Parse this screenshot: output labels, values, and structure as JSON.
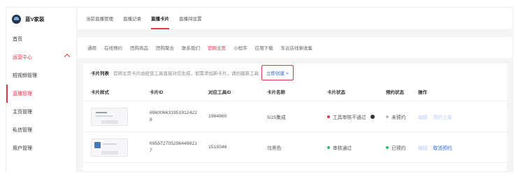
{
  "app": {
    "logo_text": "蓝V家装"
  },
  "sidebar": {
    "items": [
      {
        "label": "首页",
        "state": "normal"
      },
      {
        "label": "运营中心",
        "state": "group"
      },
      {
        "label": "短视频管理",
        "state": "normal"
      },
      {
        "label": "直播管理",
        "state": "active"
      },
      {
        "label": "主页管理",
        "state": "normal"
      },
      {
        "label": "私信管理",
        "state": "normal"
      },
      {
        "label": "用户管理",
        "state": "normal"
      }
    ]
  },
  "topbar": {
    "tabs": [
      {
        "label": "当前直播管理",
        "active": false
      },
      {
        "label": "直播记录",
        "active": false
      },
      {
        "label": "直播卡片",
        "active": true
      },
      {
        "label": "直播间设置",
        "active": false
      }
    ]
  },
  "subtabs": [
    {
      "label": "通用",
      "active": false
    },
    {
      "label": "在线预约",
      "active": false
    },
    {
      "label": "团购商品",
      "active": false
    },
    {
      "label": "团购聚合",
      "active": false
    },
    {
      "label": "联系我们",
      "active": false
    },
    {
      "label": "官网主页",
      "active": true
    },
    {
      "label": "小程序",
      "active": false
    },
    {
      "label": "应用下载",
      "active": false
    },
    {
      "label": "车云店线索收集",
      "active": false
    }
  ],
  "panel": {
    "title": "卡片列表",
    "description": "官网主页卡片由经营工具直接对应生成，如需添加新卡片，请创建新工具",
    "create_link": "立即创建 >"
  },
  "table": {
    "headers": [
      "卡片样式",
      "卡片ID",
      "对应工具ID",
      "卡片名称",
      "卡片状态",
      "预约状态",
      "操作"
    ],
    "rows": [
      {
        "card_id": "6960066319519124228",
        "tool_id": "1964860",
        "name": "5/25集成",
        "status": "工具审核不通过",
        "status_color": "#e8334a",
        "reserve": "未预约",
        "reserve_color": "#b7bcc4",
        "actions": [
          "编辑",
          "预约上架"
        ],
        "thumb": "text"
      },
      {
        "card_id": "6955727052964498217",
        "tool_id": "1518346",
        "name": "乌黑色",
        "status": "审核通过",
        "status_color": "#2bb96b",
        "reserve": "已预约",
        "reserve_color": "#2bb96b",
        "actions": [
          "编辑",
          "取消预约"
        ],
        "thumb": "avatar"
      }
    ]
  }
}
